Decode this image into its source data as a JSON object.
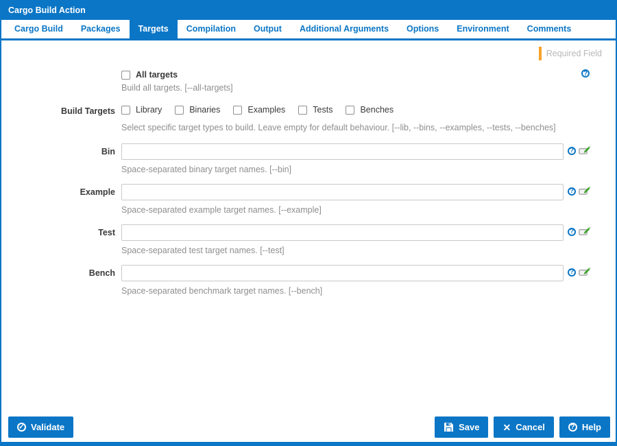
{
  "colors": {
    "accent": "#0b76c6",
    "required_bar": "#f5a42c",
    "variable_icon_green": "#3fa32e"
  },
  "window": {
    "title": "Cargo Build Action"
  },
  "tabs": [
    {
      "label": "Cargo Build",
      "active": false
    },
    {
      "label": "Packages",
      "active": false
    },
    {
      "label": "Targets",
      "active": true
    },
    {
      "label": "Compilation",
      "active": false
    },
    {
      "label": "Output",
      "active": false
    },
    {
      "label": "Additional Arguments",
      "active": false
    },
    {
      "label": "Options",
      "active": false
    },
    {
      "label": "Environment",
      "active": false
    },
    {
      "label": "Comments",
      "active": false
    }
  ],
  "legend": {
    "required": "Required Field"
  },
  "form": {
    "all_targets": {
      "label": "All targets",
      "checked": false,
      "desc": "Build all targets. [--all-targets]",
      "help_icon": "help-circle-icon"
    },
    "build_targets": {
      "label": "Build Targets",
      "desc": "Select specific target types to build. Leave empty for default behaviour. [--lib, --bins, --examples, --tests, --benches]",
      "options": [
        {
          "label": "Library",
          "checked": false
        },
        {
          "label": "Binaries",
          "checked": false
        },
        {
          "label": "Examples",
          "checked": false
        },
        {
          "label": "Tests",
          "checked": false
        },
        {
          "label": "Benches",
          "checked": false
        }
      ]
    },
    "fields": [
      {
        "label": "Bin",
        "value": "",
        "desc": "Space-separated binary target names. [--bin]"
      },
      {
        "label": "Example",
        "value": "",
        "desc": "Space-separated example target names. [--example]"
      },
      {
        "label": "Test",
        "value": "",
        "desc": "Space-separated test target names. [--test]"
      },
      {
        "label": "Bench",
        "value": "",
        "desc": "Space-separated benchmark target names. [--bench]"
      }
    ]
  },
  "footer": {
    "validate": "Validate",
    "save": "Save",
    "cancel": "Cancel",
    "help": "Help"
  }
}
